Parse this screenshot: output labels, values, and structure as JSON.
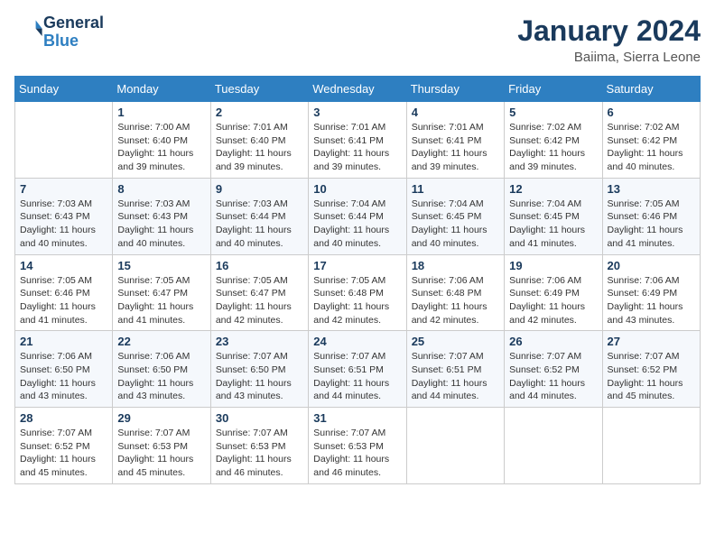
{
  "header": {
    "logo_line1": "General",
    "logo_line2": "Blue",
    "month_title": "January 2024",
    "location": "Baiima, Sierra Leone"
  },
  "weekdays": [
    "Sunday",
    "Monday",
    "Tuesday",
    "Wednesday",
    "Thursday",
    "Friday",
    "Saturday"
  ],
  "weeks": [
    [
      {
        "day": "",
        "info": ""
      },
      {
        "day": "1",
        "info": "Sunrise: 7:00 AM\nSunset: 6:40 PM\nDaylight: 11 hours\nand 39 minutes."
      },
      {
        "day": "2",
        "info": "Sunrise: 7:01 AM\nSunset: 6:40 PM\nDaylight: 11 hours\nand 39 minutes."
      },
      {
        "day": "3",
        "info": "Sunrise: 7:01 AM\nSunset: 6:41 PM\nDaylight: 11 hours\nand 39 minutes."
      },
      {
        "day": "4",
        "info": "Sunrise: 7:01 AM\nSunset: 6:41 PM\nDaylight: 11 hours\nand 39 minutes."
      },
      {
        "day": "5",
        "info": "Sunrise: 7:02 AM\nSunset: 6:42 PM\nDaylight: 11 hours\nand 39 minutes."
      },
      {
        "day": "6",
        "info": "Sunrise: 7:02 AM\nSunset: 6:42 PM\nDaylight: 11 hours\nand 40 minutes."
      }
    ],
    [
      {
        "day": "7",
        "info": ""
      },
      {
        "day": "8",
        "info": "Sunrise: 7:03 AM\nSunset: 6:43 PM\nDaylight: 11 hours\nand 40 minutes."
      },
      {
        "day": "9",
        "info": "Sunrise: 7:03 AM\nSunset: 6:44 PM\nDaylight: 11 hours\nand 40 minutes."
      },
      {
        "day": "10",
        "info": "Sunrise: 7:04 AM\nSunset: 6:44 PM\nDaylight: 11 hours\nand 40 minutes."
      },
      {
        "day": "11",
        "info": "Sunrise: 7:04 AM\nSunset: 6:45 PM\nDaylight: 11 hours\nand 40 minutes."
      },
      {
        "day": "12",
        "info": "Sunrise: 7:04 AM\nSunset: 6:45 PM\nDaylight: 11 hours\nand 41 minutes."
      },
      {
        "day": "13",
        "info": "Sunrise: 7:05 AM\nSunset: 6:46 PM\nDaylight: 11 hours\nand 41 minutes."
      }
    ],
    [
      {
        "day": "14",
        "info": ""
      },
      {
        "day": "15",
        "info": "Sunrise: 7:05 AM\nSunset: 6:47 PM\nDaylight: 11 hours\nand 41 minutes."
      },
      {
        "day": "16",
        "info": "Sunrise: 7:05 AM\nSunset: 6:47 PM\nDaylight: 11 hours\nand 42 minutes."
      },
      {
        "day": "17",
        "info": "Sunrise: 7:05 AM\nSunset: 6:48 PM\nDaylight: 11 hours\nand 42 minutes."
      },
      {
        "day": "18",
        "info": "Sunrise: 7:06 AM\nSunset: 6:48 PM\nDaylight: 11 hours\nand 42 minutes."
      },
      {
        "day": "19",
        "info": "Sunrise: 7:06 AM\nSunset: 6:49 PM\nDaylight: 11 hours\nand 42 minutes."
      },
      {
        "day": "20",
        "info": "Sunrise: 7:06 AM\nSunset: 6:49 PM\nDaylight: 11 hours\nand 43 minutes."
      }
    ],
    [
      {
        "day": "21",
        "info": ""
      },
      {
        "day": "22",
        "info": "Sunrise: 7:06 AM\nSunset: 6:50 PM\nDaylight: 11 hours\nand 43 minutes."
      },
      {
        "day": "23",
        "info": "Sunrise: 7:07 AM\nSunset: 6:50 PM\nDaylight: 11 hours\nand 43 minutes."
      },
      {
        "day": "24",
        "info": "Sunrise: 7:07 AM\nSunset: 6:51 PM\nDaylight: 11 hours\nand 44 minutes."
      },
      {
        "day": "25",
        "info": "Sunrise: 7:07 AM\nSunset: 6:51 PM\nDaylight: 11 hours\nand 44 minutes."
      },
      {
        "day": "26",
        "info": "Sunrise: 7:07 AM\nSunset: 6:52 PM\nDaylight: 11 hours\nand 44 minutes."
      },
      {
        "day": "27",
        "info": "Sunrise: 7:07 AM\nSunset: 6:52 PM\nDaylight: 11 hours\nand 45 minutes."
      }
    ],
    [
      {
        "day": "28",
        "info": ""
      },
      {
        "day": "29",
        "info": "Sunrise: 7:07 AM\nSunset: 6:53 PM\nDaylight: 11 hours\nand 45 minutes."
      },
      {
        "day": "30",
        "info": "Sunrise: 7:07 AM\nSunset: 6:53 PM\nDaylight: 11 hours\nand 46 minutes."
      },
      {
        "day": "31",
        "info": "Sunrise: 7:07 AM\nSunset: 6:53 PM\nDaylight: 11 hours\nand 46 minutes."
      },
      {
        "day": "",
        "info": ""
      },
      {
        "day": "",
        "info": ""
      },
      {
        "day": "",
        "info": ""
      }
    ]
  ],
  "week1_sun_info": "Sunrise: 7:03 AM\nSunset: 6:43 PM\nDaylight: 11 hours\nand 40 minutes.",
  "week2_sun_info": "Sunrise: 7:05 AM\nSunset: 6:46 PM\nDaylight: 11 hours\nand 41 minutes.",
  "week3_sun_info": "Sunrise: 7:06 AM\nSunset: 6:50 PM\nDaylight: 11 hours\nand 43 minutes.",
  "week4_sun_info": "Sunrise: 7:07 AM\nSunset: 6:52 PM\nDaylight: 11 hours\nand 45 minutes."
}
